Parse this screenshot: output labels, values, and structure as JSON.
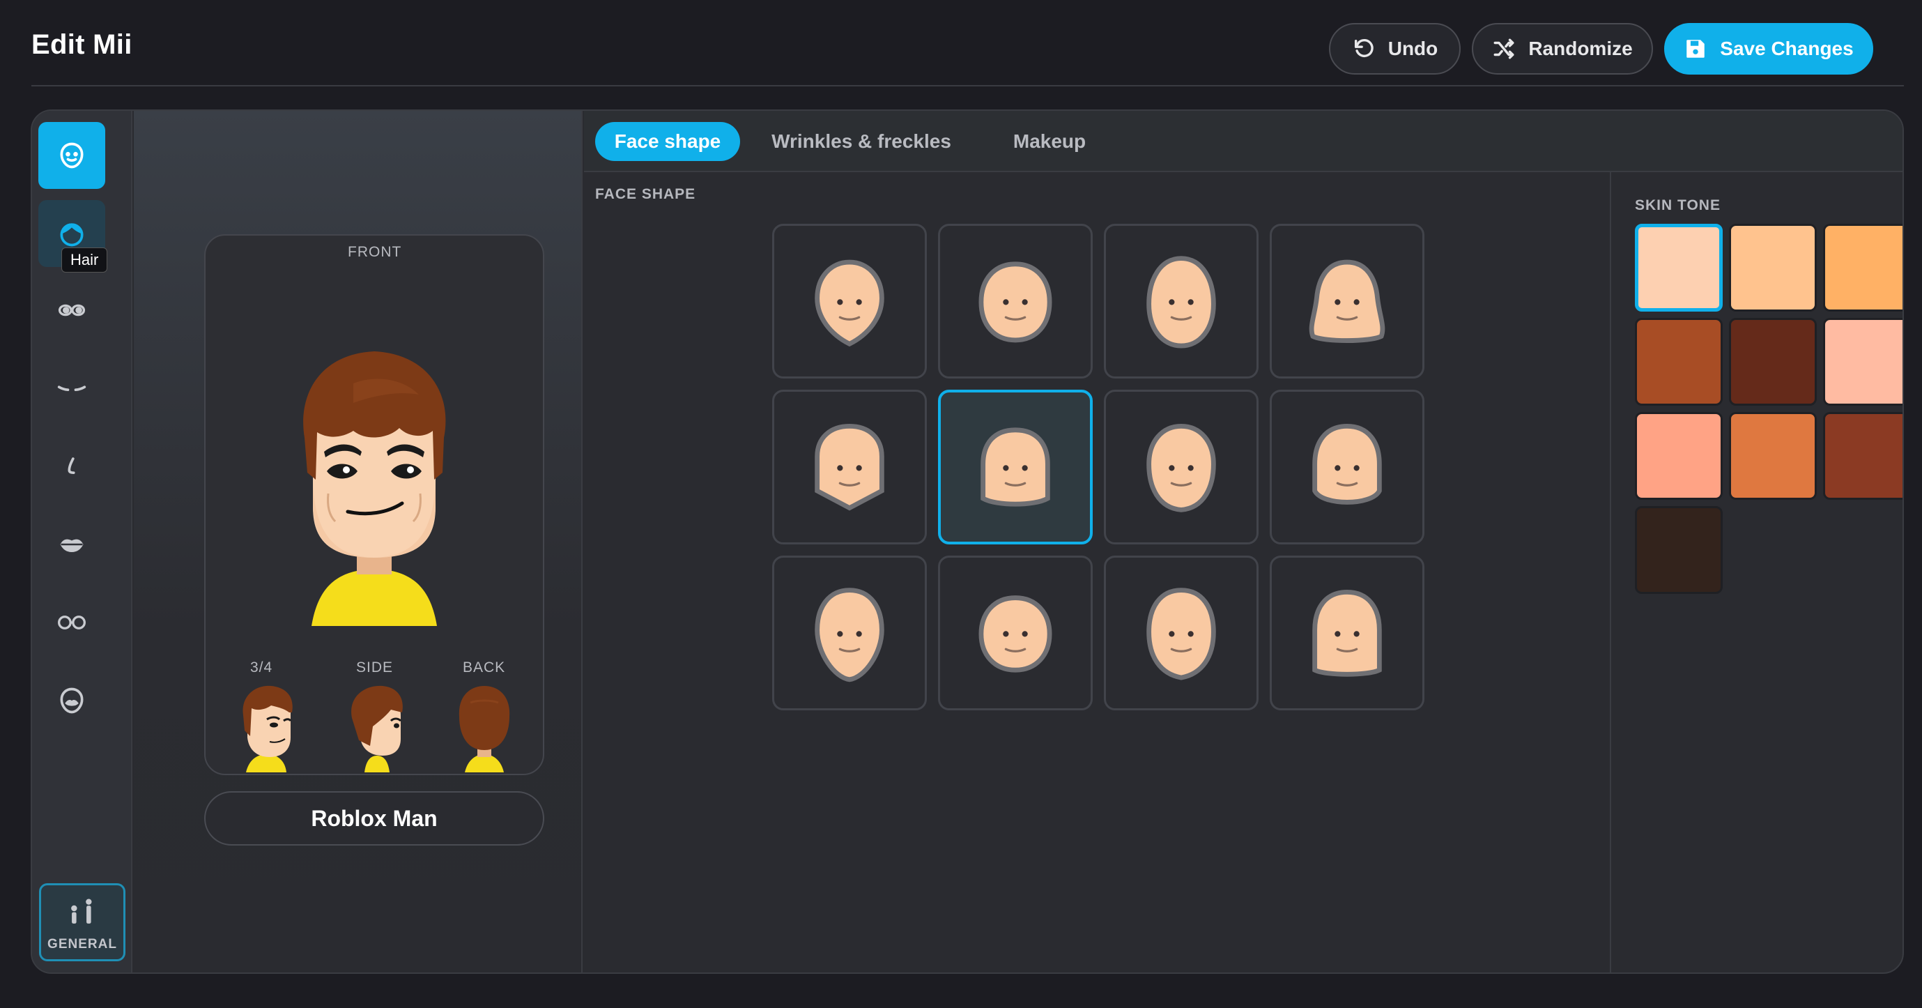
{
  "header": {
    "title": "Edit Mii",
    "undo_label": "Undo",
    "randomize_label": "Randomize",
    "save_label": "Save Changes"
  },
  "rail": {
    "items": [
      {
        "name": "face",
        "icon": "face-icon",
        "active": true
      },
      {
        "name": "hair",
        "icon": "hair-icon",
        "hovered": true
      },
      {
        "name": "eyes",
        "icon": "eyes-icon"
      },
      {
        "name": "eyebrows",
        "icon": "eyebrows-icon"
      },
      {
        "name": "nose",
        "icon": "nose-icon"
      },
      {
        "name": "mouth",
        "icon": "mouth-icon"
      },
      {
        "name": "glasses",
        "icon": "glasses-icon"
      },
      {
        "name": "mustache",
        "icon": "mustache-icon"
      }
    ],
    "tooltip": "Hair",
    "general_label": "GENERAL"
  },
  "preview": {
    "front_label": "FRONT",
    "three_quarter_label": "3/4",
    "side_label": "SIDE",
    "back_label": "BACK",
    "mii_name": "Roblox Man"
  },
  "tabs": [
    {
      "label": "Face shape",
      "active": true
    },
    {
      "label": "Wrinkles & freckles"
    },
    {
      "label": "Makeup"
    }
  ],
  "face_shape": {
    "section_label": "FACE SHAPE",
    "selected_index": 5,
    "count": 12
  },
  "skin_tone": {
    "section_label": "SKIN TONE",
    "selected_index": 0,
    "colors": [
      "#fdd0b1",
      "#ffc38e",
      "#ffb165",
      "#a84d25",
      "#652a1a",
      "#ffbba2",
      "#ffa385",
      "#df7840",
      "#8b3a23",
      "#33231c"
    ]
  },
  "colors": {
    "accent": "#10b0ea",
    "face_skin": "#f9c9a2",
    "shirt": "#f5dd1b",
    "hair": "#7d3a16"
  }
}
